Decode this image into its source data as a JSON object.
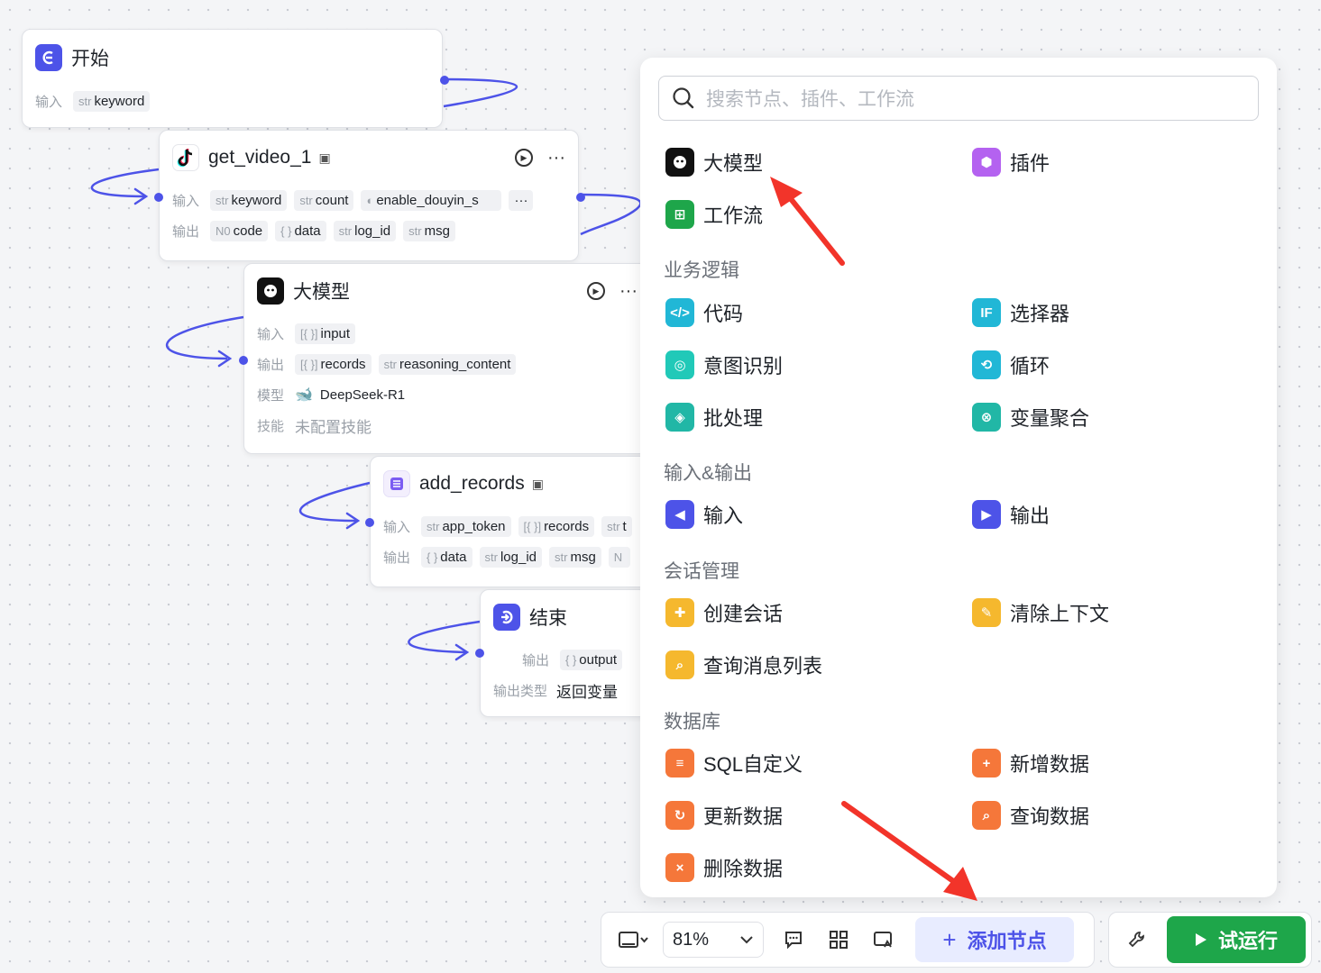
{
  "nodes": {
    "start": {
      "title": "开始",
      "input_label": "输入",
      "inputs": [
        {
          "type": "str",
          "name": "keyword"
        }
      ]
    },
    "get_video": {
      "title": "get_video_1",
      "input_label": "输入",
      "output_label": "输出",
      "inputs": [
        {
          "type": "str",
          "name": "keyword"
        },
        {
          "type": "str",
          "name": "count"
        },
        {
          "type": "toggle",
          "name": "enable_douyin_s"
        }
      ],
      "outputs": [
        {
          "type": "N0",
          "name": "code"
        },
        {
          "type": "{ }",
          "name": "data"
        },
        {
          "type": "str",
          "name": "log_id"
        },
        {
          "type": "str",
          "name": "msg"
        }
      ]
    },
    "llm": {
      "title": "大模型",
      "input_label": "输入",
      "output_label": "输出",
      "model_label": "模型",
      "skill_label": "技能",
      "inputs": [
        {
          "type": "[{ }]",
          "name": "input"
        }
      ],
      "outputs": [
        {
          "type": "[{ }]",
          "name": "records"
        },
        {
          "type": "str",
          "name": "reasoning_content"
        }
      ],
      "model": "DeepSeek-R1",
      "skill": "未配置技能"
    },
    "add_records": {
      "title": "add_records",
      "input_label": "输入",
      "output_label": "输出",
      "inputs": [
        {
          "type": "str",
          "name": "app_token"
        },
        {
          "type": "[{ }]",
          "name": "records"
        },
        {
          "type": "str",
          "name": "t"
        }
      ],
      "outputs": [
        {
          "type": "{ }",
          "name": "data"
        },
        {
          "type": "str",
          "name": "log_id"
        },
        {
          "type": "str",
          "name": "msg"
        },
        {
          "type": "N",
          "name": ""
        }
      ]
    },
    "end": {
      "title": "结束",
      "output_label": "输出",
      "output": {
        "type": "{ }",
        "name": "output"
      },
      "output_type_label": "输出类型",
      "output_type": "返回变量"
    }
  },
  "panel": {
    "search_placeholder": "搜索节点、插件、工作流",
    "top_items": {
      "llm": "大模型",
      "plugin": "插件",
      "workflow": "工作流"
    },
    "sections": {
      "logic": {
        "title": "业务逻辑",
        "items": [
          "代码",
          "选择器",
          "意图识别",
          "循环",
          "批处理",
          "变量聚合"
        ]
      },
      "io": {
        "title": "输入&输出",
        "items": [
          "输入",
          "输出"
        ]
      },
      "conversation": {
        "title": "会话管理",
        "items": [
          "创建会话",
          "清除上下文",
          "查询消息列表"
        ]
      },
      "database": {
        "title": "数据库",
        "items": [
          "SQL自定义",
          "新增数据",
          "更新数据",
          "查询数据",
          "删除数据"
        ]
      }
    }
  },
  "toolbar": {
    "zoom": "81%",
    "add_node": "添加节点",
    "run": "试运行"
  },
  "colors": {
    "accent": "#4d53e8",
    "run_green": "#1ea64a",
    "arrow_red": "#f2342a"
  }
}
